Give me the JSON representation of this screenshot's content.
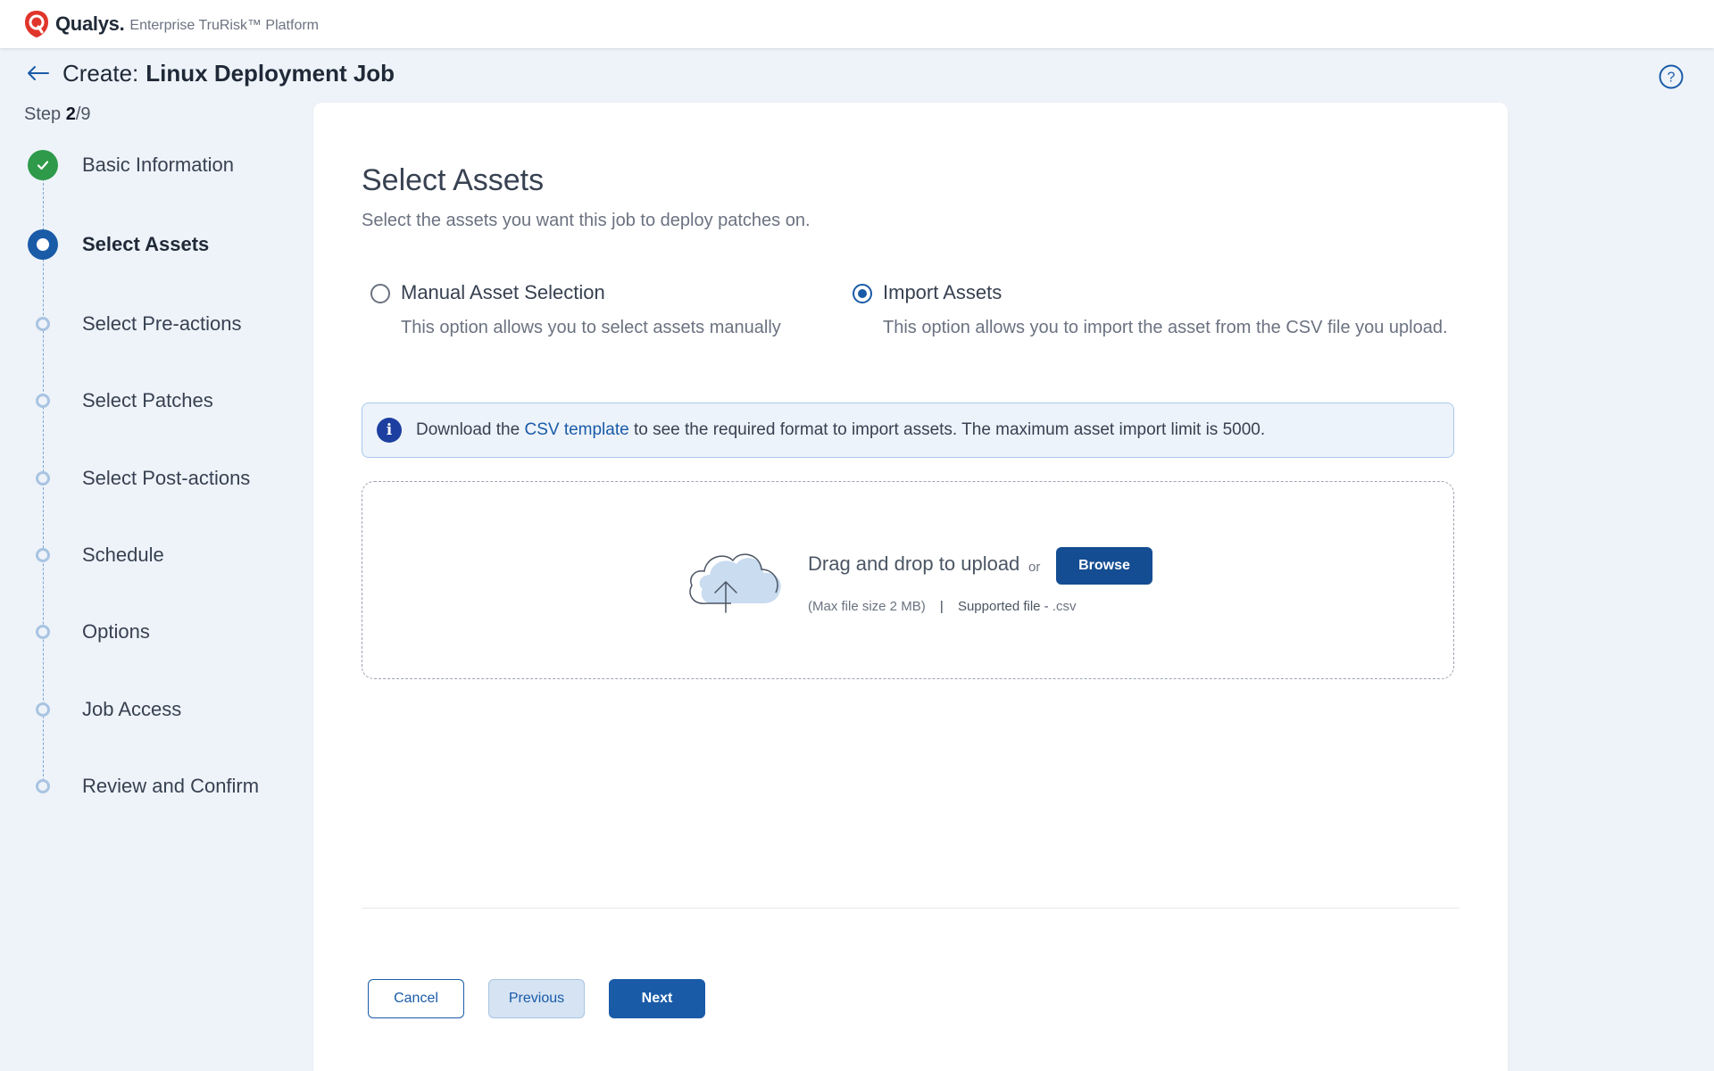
{
  "brand": {
    "name": "Qualys.",
    "platform": "Enterprise TruRisk™ Platform",
    "icon": "qualys-shield-logo"
  },
  "header": {
    "prefix": "Create:",
    "job_name": "Linux Deployment Job"
  },
  "step_counter": {
    "label": "Step",
    "current": "2",
    "total": "/9"
  },
  "steps": [
    {
      "label": "Basic Information",
      "status": "done"
    },
    {
      "label": "Select Assets",
      "status": "current"
    },
    {
      "label": "Select Pre-actions",
      "status": "pending"
    },
    {
      "label": "Select Patches",
      "status": "pending"
    },
    {
      "label": "Select Post-actions",
      "status": "pending"
    },
    {
      "label": "Schedule",
      "status": "pending"
    },
    {
      "label": "Options",
      "status": "pending"
    },
    {
      "label": "Job Access",
      "status": "pending"
    },
    {
      "label": "Review and Confirm",
      "status": "pending"
    }
  ],
  "main": {
    "title": "Select Assets",
    "subtitle": "Select the assets you want this job to deploy patches on.",
    "options": [
      {
        "label": "Manual Asset Selection",
        "desc": "This option allows you to select assets manually",
        "checked": false
      },
      {
        "label": "Import Assets",
        "desc": "This option allows you to import the asset from the CSV file you upload.",
        "checked": true
      }
    ],
    "info": {
      "before": "Download the ",
      "link": "CSV template",
      "after": " to see the required format to import assets. The maximum asset import limit is 5000."
    },
    "dropzone": {
      "text": "Drag and drop to upload",
      "or": "or",
      "browse": "Browse",
      "max_size": "(Max file size 2 MB)",
      "separator": "|",
      "supported_label": "Supported file -",
      "supported_ext": ".csv"
    }
  },
  "footer": {
    "cancel": "Cancel",
    "previous": "Previous",
    "next": "Next"
  },
  "colors": {
    "primary": "#1a5ba8",
    "success": "#2e9a4a",
    "brand_red": "#e0352b"
  }
}
